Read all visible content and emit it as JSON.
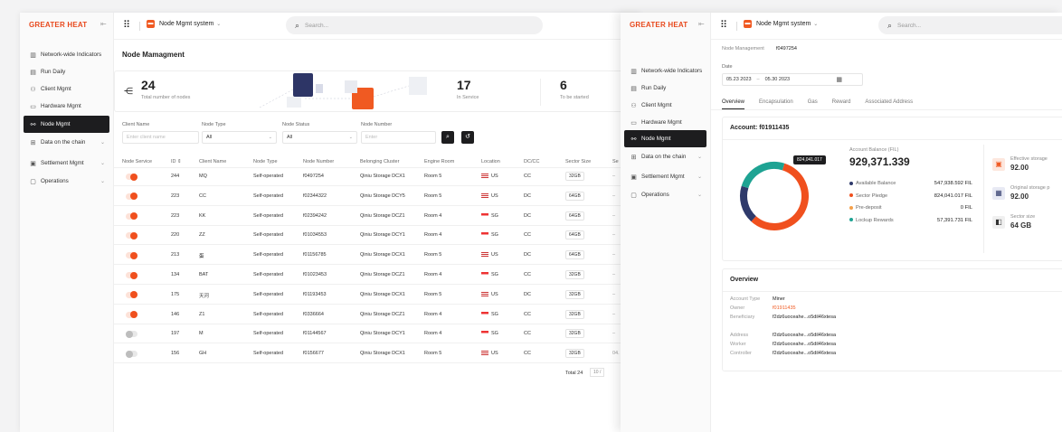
{
  "brand": {
    "logo": "GREATER HEAT",
    "accent": "#f05a22"
  },
  "nav": [
    {
      "label": "Network-wide Indicators",
      "icon": "bar-chart-icon",
      "glyph": "▥"
    },
    {
      "label": "Run Daily",
      "icon": "calendar-icon",
      "glyph": "▤"
    },
    {
      "label": "Client Mgmt",
      "icon": "user-icon",
      "glyph": "⚇"
    },
    {
      "label": "Hardware Mgmt",
      "icon": "hardware-icon",
      "glyph": "▭"
    },
    {
      "label": "Node Mgmt",
      "icon": "node-icon",
      "glyph": "⚯"
    },
    {
      "label": "Data on the chain",
      "icon": "chain-icon",
      "glyph": "⊞"
    },
    {
      "label": "Settlement Mgmt",
      "icon": "settlement-icon",
      "glyph": "▣"
    },
    {
      "label": "Operations",
      "icon": "operations-icon",
      "glyph": "▢"
    }
  ],
  "topbar": {
    "system": "Node Mgmt system",
    "search_placeholder": "Search..."
  },
  "left": {
    "title": "Node Mamagment",
    "stats": {
      "total": "24",
      "total_label": "Total number of nodes",
      "in_service": "17",
      "in_service_label": "In Service",
      "to_be_started": "6",
      "to_be_started_label": "To be started"
    },
    "filters": {
      "client_name": "Client Name",
      "client_placeholder": "Enter client name",
      "node_type": "Node Type",
      "node_type_value": "All",
      "node_status": "Node Status",
      "node_status_value": "All",
      "node_number": "Node Number",
      "node_number_placeholder": "Enter"
    },
    "columns": [
      "Node Service",
      "ID ⇕",
      "Client Name",
      "Node Type",
      "Node Number",
      "Belonging Cluster",
      "Engine Room",
      "Location",
      "DC/CC",
      "Sector Size",
      "Se"
    ],
    "rows": [
      {
        "on": true,
        "id": "244",
        "client": "MQ",
        "type": "Self-operated",
        "number": "f0497254",
        "cluster": "Qiniu Storage DCX1",
        "room": "Room 5",
        "loc": "US",
        "dc": "CC",
        "size": "32GB",
        "extra": "–"
      },
      {
        "on": true,
        "id": "223",
        "client": "CC",
        "type": "Self-operated",
        "number": "f02344322",
        "cluster": "Qiniu Storage DCY5",
        "room": "Room 5",
        "loc": "US",
        "dc": "DC",
        "size": "64GB",
        "extra": "–"
      },
      {
        "on": true,
        "id": "223",
        "client": "KK",
        "type": "Self-operated",
        "number": "f02394242",
        "cluster": "Qiniu Storage DCZ1",
        "room": "Room 4",
        "loc": "SG",
        "dc": "DC",
        "size": "64GB",
        "extra": "–"
      },
      {
        "on": true,
        "id": "220",
        "client": "ZZ",
        "type": "Self-operated",
        "number": "f01034553",
        "cluster": "Qiniu Storage DCY1",
        "room": "Room 4",
        "loc": "SG",
        "dc": "CC",
        "size": "64GB",
        "extra": "–"
      },
      {
        "on": true,
        "id": "213",
        "client": "蛋",
        "type": "Self-operated",
        "number": "f01156785",
        "cluster": "Qiniu Storage DCX1",
        "room": "Room 5",
        "loc": "US",
        "dc": "DC",
        "size": "64GB",
        "extra": "–"
      },
      {
        "on": true,
        "id": "134",
        "client": "BAT",
        "type": "Self-operated",
        "number": "f01023453",
        "cluster": "Qiniu Storage DCZ1",
        "room": "Room 4",
        "loc": "SG",
        "dc": "CC",
        "size": "32GB",
        "extra": "–"
      },
      {
        "on": true,
        "id": "175",
        "client": "天河",
        "type": "Self-operated",
        "number": "f01193453",
        "cluster": "Qiniu Storage DCX1",
        "room": "Room 5",
        "loc": "US",
        "dc": "DC",
        "size": "32GB",
        "extra": "–"
      },
      {
        "on": true,
        "id": "146",
        "client": "Z1",
        "type": "Self-operated",
        "number": "f0336664",
        "cluster": "Qiniu Storage DCZ1",
        "room": "Room 4",
        "loc": "SG",
        "dc": "CC",
        "size": "32GB",
        "extra": "–"
      },
      {
        "on": false,
        "id": "197",
        "client": "M",
        "type": "Self-operated",
        "number": "f01144567",
        "cluster": "Qiniu Storage DCY1",
        "room": "Room 4",
        "loc": "SG",
        "dc": "CC",
        "size": "32GB",
        "extra": "–"
      },
      {
        "on": false,
        "id": "156",
        "client": "GH",
        "type": "Self-operated",
        "number": "f0156677",
        "cluster": "Qiniu Storage DCX1",
        "room": "Room 5",
        "loc": "US",
        "dc": "CC",
        "size": "32GB",
        "extra": "04."
      }
    ],
    "footer": {
      "total": "Total 24",
      "per_page": "10 /"
    }
  },
  "right": {
    "breadcrumb": {
      "section": "Node Management",
      "current": "f0497254"
    },
    "date_label": "Date",
    "date_range": {
      "from": "05.23 2023",
      "to": "05.30 2023"
    },
    "tabs": [
      "Overview",
      "Encapsulation",
      "Gas",
      "Reward",
      "Associated Address"
    ],
    "account": {
      "title": "Account: f01911435",
      "balance_label": "Account Balance (FIL)",
      "balance": "929,371.339",
      "tooltip": "824,041.017",
      "legend": [
        {
          "label": "Available Balance",
          "value": "547,938.592 FIL",
          "color": "#2f3a6b"
        },
        {
          "label": "Sector Pledge",
          "value": "824,041.017 FIL",
          "color": "#f0501e"
        },
        {
          "label": "Pre-deposit",
          "value": "0 FIL",
          "color": "#f5a04a"
        },
        {
          "label": "Lockup Rewards",
          "value": "57,391.731 FIL",
          "color": "#1ea393"
        }
      ],
      "donut": [
        {
          "name": "Sector Pledge",
          "fraction": 0.57,
          "color": "#f0501e"
        },
        {
          "name": "Available Balance",
          "fraction": 0.18,
          "color": "#2f3a6b"
        },
        {
          "name": "Lockup Rewards",
          "fraction": 0.25,
          "color": "#1ea393"
        }
      ],
      "metrics": [
        {
          "label": "Effective storage",
          "value": "92.00",
          "icon": "chip-icon"
        },
        {
          "label": "Original storage p",
          "value": "92.00",
          "icon": "processor-icon"
        },
        {
          "label": "Sector size",
          "value": "64 GB",
          "icon": "cube-icon"
        }
      ]
    },
    "overview": {
      "title": "Overview",
      "rows": [
        {
          "k": "Account Type",
          "v": "Miner"
        },
        {
          "k": "Owner",
          "v": "f01911435"
        },
        {
          "k": "Beneficiary",
          "v": "f2dz6uoceahe...o5dil46xtesa"
        },
        {
          "k": "Address",
          "v": "f2dz6uoceahe...o5dil46xtesa"
        },
        {
          "k": "Worker",
          "v": "f2dz6uoceahe...o5dil46xtesa"
        },
        {
          "k": "Controller",
          "v": "f2dz6uoceahe...o5dil46xtesa"
        }
      ]
    }
  }
}
